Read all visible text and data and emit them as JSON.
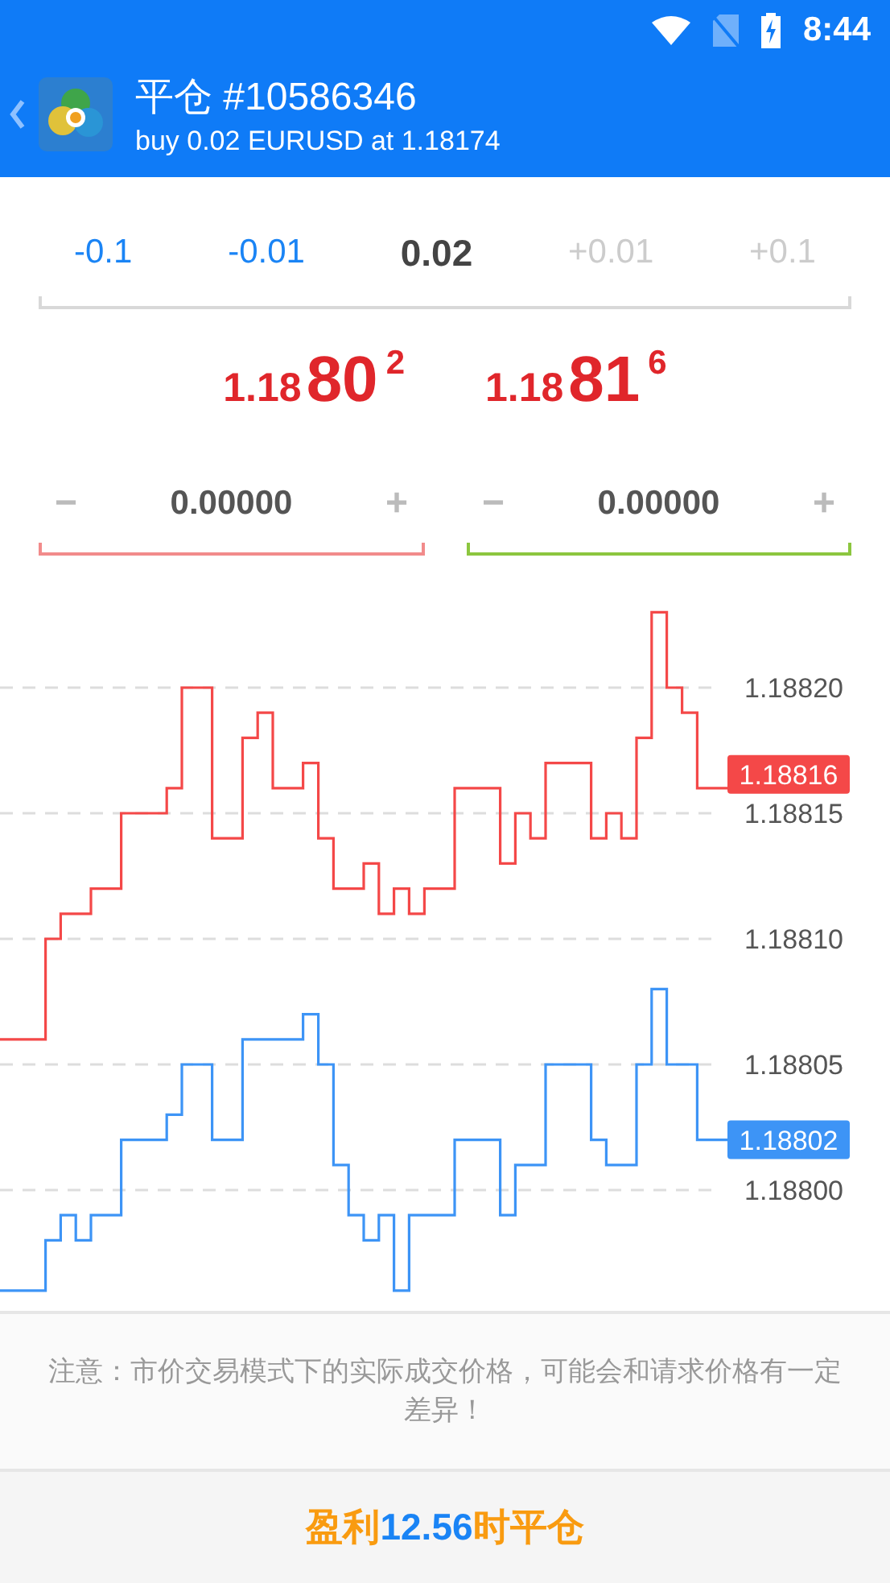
{
  "status_bar": {
    "time": "8:44"
  },
  "header": {
    "title": "平仓 #10586346",
    "subtitle": "buy 0.02 EURUSD at 1.18174"
  },
  "volume": {
    "steps": [
      {
        "label": "-0.1",
        "kind": "step",
        "disabled": false
      },
      {
        "label": "-0.01",
        "kind": "step",
        "disabled": false
      },
      {
        "label": "0.02",
        "kind": "value"
      },
      {
        "label": "+0.01",
        "kind": "step",
        "disabled": true
      },
      {
        "label": "+0.1",
        "kind": "step",
        "disabled": true
      }
    ]
  },
  "prices": [
    {
      "prefix": "1.18",
      "big": "80",
      "sup": "2"
    },
    {
      "prefix": "1.18",
      "big": "81",
      "sup": "6"
    }
  ],
  "fields": [
    {
      "minus": "−",
      "value": "0.00000",
      "plus": "+",
      "color": "#f28b8b"
    },
    {
      "minus": "−",
      "value": "0.00000",
      "plus": "+",
      "color": "#8cc63f"
    }
  ],
  "chart": {
    "y_labels": [
      "1.18820",
      "1.18815",
      "1.18810",
      "1.18805",
      "1.18800"
    ],
    "price_tags": [
      {
        "label": "1.18816",
        "color": "#f44848"
      },
      {
        "label": "1.18802",
        "color": "#3d94f6"
      }
    ]
  },
  "notice": "注意：市价交易模式下的实际成交价格，可能会和请求价格有一定差异！",
  "close_button": {
    "prefix": "盈利",
    "amount": "12.56",
    "suffix": "时平仓"
  }
}
